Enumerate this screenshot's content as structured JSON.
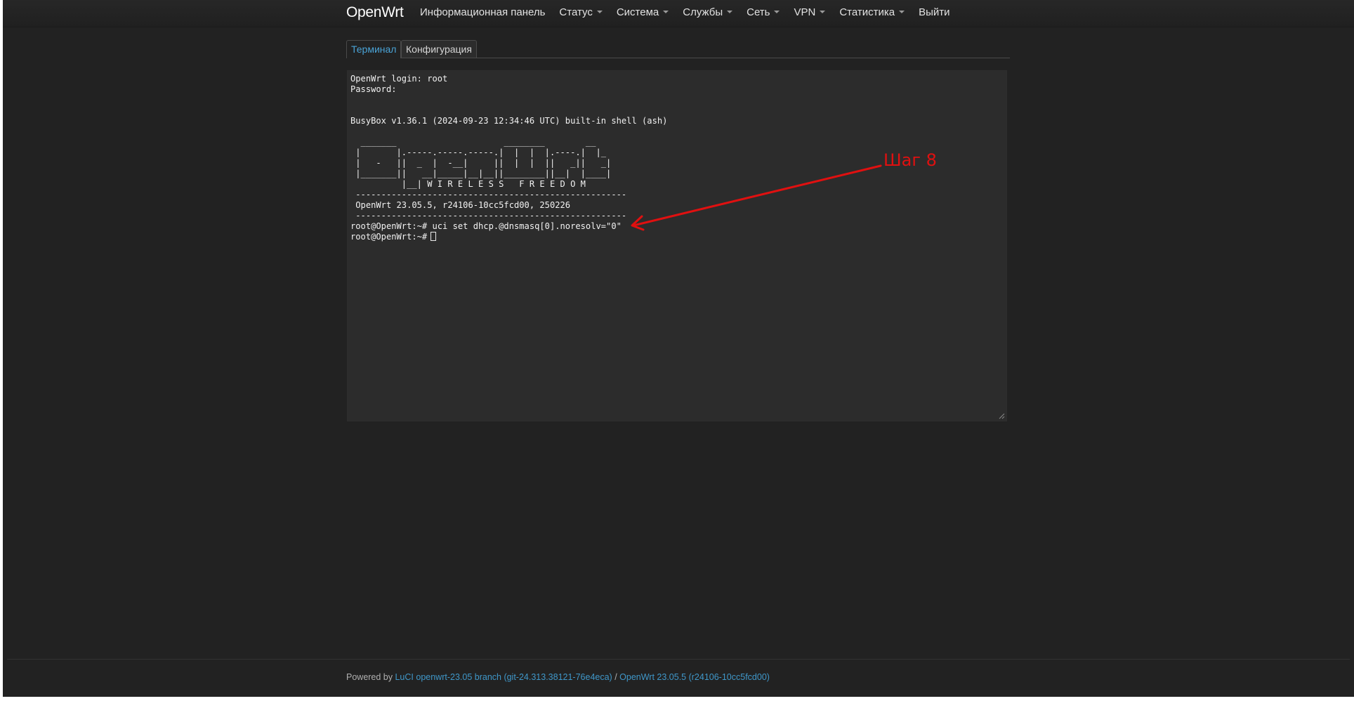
{
  "navbar": {
    "brand": "OpenWrt",
    "menu": [
      {
        "label": "Информационная панель",
        "has_dropdown": false
      },
      {
        "label": "Статус",
        "has_dropdown": true
      },
      {
        "label": "Система",
        "has_dropdown": true
      },
      {
        "label": "Службы",
        "has_dropdown": true
      },
      {
        "label": "Сеть",
        "has_dropdown": true
      },
      {
        "label": "VPN",
        "has_dropdown": true
      },
      {
        "label": "Статистика",
        "has_dropdown": true
      },
      {
        "label": "Выйти",
        "has_dropdown": false
      }
    ]
  },
  "tabs": {
    "terminal": "Терминал",
    "config": "Конфигурация"
  },
  "terminal": {
    "lines": [
      "OpenWrt login: root",
      "Password:",
      "",
      "",
      "BusyBox v1.36.1 (2024-09-23 12:34:46 UTC) built-in shell (ash)",
      "",
      "  _______                     ________        __",
      " |       |.-----.-----.-----.|  |  |  |.----.|  |_",
      " |   -   ||  _  |  -__|     ||  |  |  ||   _||   _|",
      " |_______||   __|_____|__|__||________||__|  |____|",
      "          |__| W I R E L E S S   F R E E D O M",
      " -----------------------------------------------------",
      " OpenWrt 23.05.5, r24106-10cc5fcd00, 250226",
      " -----------------------------------------------------",
      "root@OpenWrt:~# uci set dhcp.@dnsmasq[0].noresolv=\"0\"",
      "root@OpenWrt:~# "
    ]
  },
  "annotation": {
    "label": "Шаг 8",
    "color": "#e01010"
  },
  "footer": {
    "prefix": "Powered by ",
    "luci_link": "LuCI openwrt-23.05 branch (git-24.313.38121-76e4eca)",
    "separator": " / ",
    "openwrt_link": "OpenWrt 23.05.5 (r24106-10cc5fcd00)"
  }
}
